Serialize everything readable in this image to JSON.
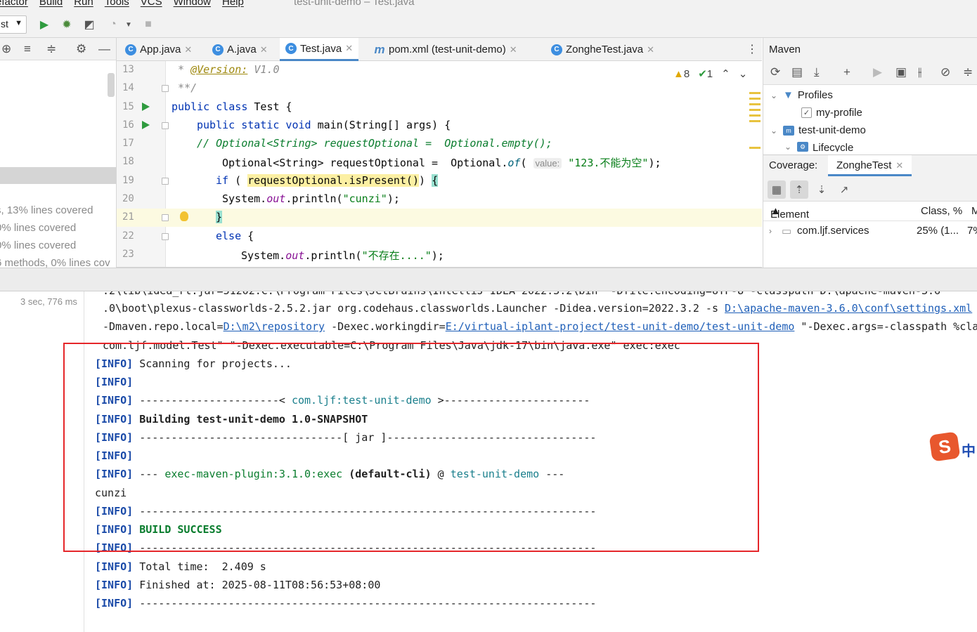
{
  "window": {
    "title": "test-unit-demo – Test.java",
    "menu": [
      "efactor",
      "Build",
      "Run",
      "Tools",
      "VCS",
      "Window",
      "Help"
    ]
  },
  "toolbar": {
    "run_config": "st"
  },
  "project_pane": {
    "coverage_lines": [
      "s, 13% lines covered",
      "0% lines covered",
      "0% lines covered",
      "6 methods, 0% lines cov"
    ]
  },
  "editor": {
    "tabs": [
      {
        "label": "App.java",
        "icon": "class-icon"
      },
      {
        "label": "A.java",
        "icon": "class-icon"
      },
      {
        "label": "Test.java",
        "icon": "class-icon",
        "active": true
      },
      {
        "label": "pom.xml (test-unit-demo)",
        "icon": "maven-icon"
      },
      {
        "label": "ZongheTest.java",
        "icon": "class-icon"
      }
    ],
    "inspections": {
      "warnings": "8",
      "ok": "1"
    },
    "line_numbers": [
      "13",
      "14",
      "15",
      "16",
      "17",
      "18",
      "19",
      "20",
      "21",
      "22",
      "23"
    ],
    "code": {
      "l13_star": " * ",
      "l13_ann": "@Version:",
      "l13_rest": " V1.0",
      "l14": " **/",
      "l15_kw": "public class",
      "l15_rest": " Test {",
      "l16_kw": "public static void",
      "l16_rest": " main(String[] args) {",
      "l17": "// Optional<String> requestOptional =  Optional.empty();",
      "l18_a": "Optional<String> requestOptional =  Optional.",
      "l18_method": "of",
      "l18_paren": "(",
      "l18_hint": "value:",
      "l18_str": "\"123.不能为空\"",
      "l18_end": ");",
      "l19_kw": "if",
      "l19_open": " ( ",
      "l19_cond": "requestOptional.isPresent()",
      "l19_close": ") ",
      "l19_brace": "{",
      "l20_a": "System.",
      "l20_out": "out",
      "l20_b": ".println(",
      "l20_str": "\"cunzi\"",
      "l20_end": ");",
      "l21_brace": "}",
      "l22_kw": "else",
      "l22_rest": " {",
      "l23_a": "System.",
      "l23_out": "out",
      "l23_b": ".println(",
      "l23_str": "\"不存在....\"",
      "l23_end": ");"
    }
  },
  "maven": {
    "title": "Maven",
    "tree": {
      "profiles": "Profiles",
      "profile_item": "my-profile",
      "project": "test-unit-demo",
      "lifecycle": "Lifecycle"
    }
  },
  "coverage": {
    "title": "Coverage:",
    "tab": "ZongheTest",
    "columns": {
      "element": "Element",
      "class_pct": "Class, %",
      "more": "M"
    },
    "row": {
      "element": "com.ljf.services",
      "class_pct": "25% (1...",
      "more": "7%"
    }
  },
  "run": {
    "elapsed": "3 sec, 776 ms",
    "cmd_top": ".2\\lib\\idea_rt.jar=51202:C:\\Program Files\\JetBrains\\IntelliJ IDEA 2022.3.2\\bin\" -Dfile.encoding=UTF-8 -classpath D:\\apache-maven-3.6",
    "cmd_line2_a": ".0\\boot\\plexus-classworlds-2.5.2.jar org.codehaus.classworlds.Launcher -Didea.version=2022.3.2 -s ",
    "cmd_line2_link": "D:\\apache-maven-3.6.0\\conf\\settings.xml",
    "cmd_line3_a": "-Dmaven.repo.local=",
    "cmd_line3_link1": "D:\\m2\\repository",
    "cmd_line3_b": " -Dexec.workingdir=",
    "cmd_line3_link2": "E:/virtual-iplant-project/test-unit-demo/test-unit-demo",
    "cmd_line3_c": " \"-Dexec.args=-classpath %class",
    "cmd_line4": "com.ljf.model.Test\" \"-Dexec.executable=C:\\Program Files\\Java\\jdk-17\\bin\\java.exe\" exec:exec",
    "info": "[INFO]",
    "l_scan": " Scanning for projects...",
    "l_dash_a": " ----------------------< ",
    "l_artifact": "com.ljf:test-unit-demo",
    "l_dash_b": " >-----------------------",
    "l_building": " Building test-unit-demo 1.0-SNAPSHOT",
    "l_jar": " --------------------------------[ jar ]---------------------------------",
    "l_plugin_a": " --- ",
    "l_plugin": "exec-maven-plugin:3.1.0:exec",
    "l_plugin_b": " (default-cli)",
    "l_plugin_c": " @ ",
    "l_plugin_proj": "test-unit-demo",
    "l_plugin_d": " ---",
    "l_output": "cunzi",
    "l_sep": " ------------------------------------------------------------------------",
    "l_success": " BUILD SUCCESS",
    "l_total": " Total time:  2.409 s",
    "l_finished": " Finished at: 2025-08-11T08:56:53+08:00"
  },
  "ime": {
    "badge": "S",
    "text": "中"
  },
  "colors": {
    "accent": "#4a88c7",
    "highlight_box": "#e5262a",
    "success": "#0a7d2e"
  }
}
